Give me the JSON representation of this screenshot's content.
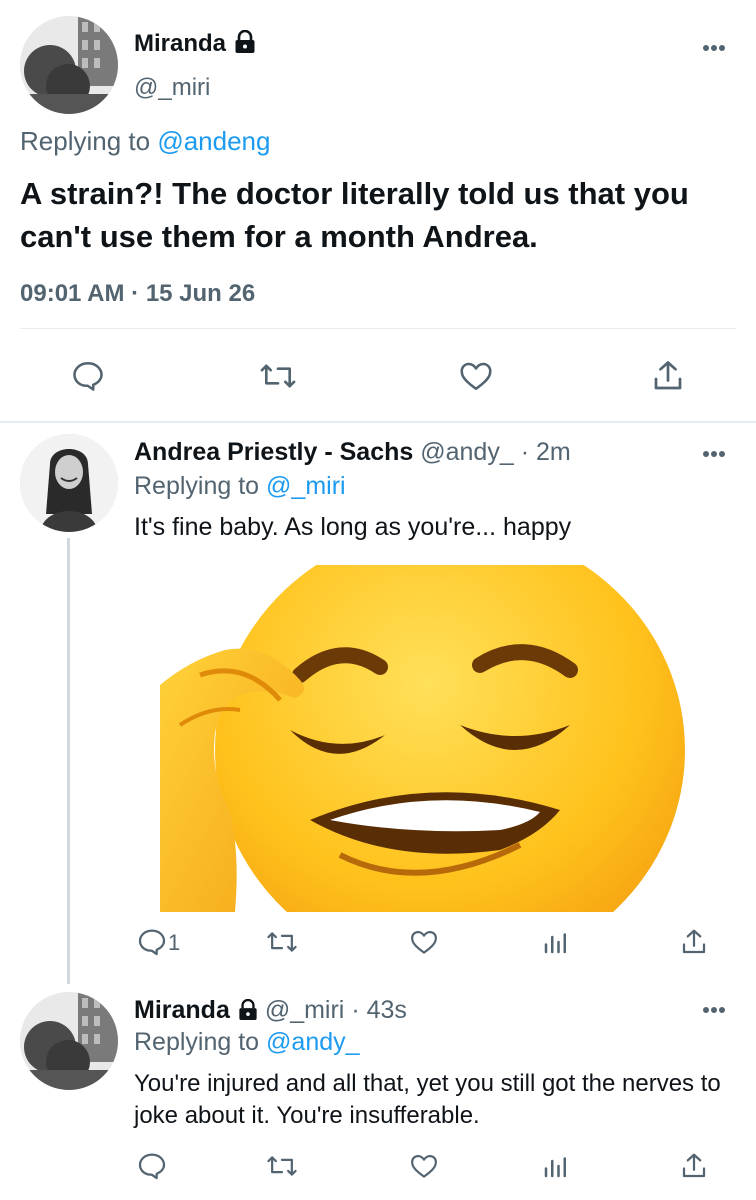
{
  "main_tweet": {
    "display_name": "Miranda",
    "handle": "@_miri",
    "replying_prefix": "Replying to ",
    "replying_to": "@andeng",
    "text": "A strain?! The doctor literally told us that you can't use them for a month Andrea.",
    "timestamp": "09:01 AM · 15 Jun 26"
  },
  "reply_1": {
    "display_name": "Andrea Priestly - Sachs",
    "handle": "@andy_",
    "time": "· 2m",
    "replying_prefix": "Replying to ",
    "replying_to": "@_miri",
    "text": "It's fine baby. As long as you're... happy",
    "reply_count": "1",
    "media_emoji": "face-palm-emoji"
  },
  "reply_2": {
    "display_name": "Miranda",
    "handle": "@_miri",
    "time": "· 43s",
    "replying_prefix": "Replying to ",
    "replying_to": "@andy_",
    "text": "You're injured and all that, yet you still got the nerves to joke about it. You're insufferable."
  },
  "colors": {
    "link": "#1d9bf0",
    "muted": "#536471",
    "text": "#0f1419",
    "divider": "#e6ecf0"
  }
}
